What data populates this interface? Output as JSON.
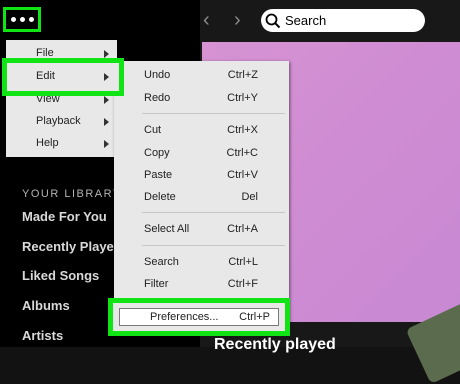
{
  "topbar": {
    "back_arrow": "‹",
    "forward_arrow": "›",
    "search_label": "Search",
    "search_icon": "search-icon"
  },
  "sidebar": {
    "library_heading": "YOUR LIBRARY",
    "items": [
      {
        "label": "Made For You"
      },
      {
        "label": "Recently Played"
      },
      {
        "label": "Liked Songs"
      },
      {
        "label": "Albums"
      },
      {
        "label": "Artists"
      }
    ]
  },
  "main": {
    "section_title": "Recently played"
  },
  "main_menu": {
    "items": [
      {
        "label": "File"
      },
      {
        "label": "Edit"
      },
      {
        "label": "View"
      },
      {
        "label": "Playback"
      },
      {
        "label": "Help"
      }
    ]
  },
  "edit_menu": {
    "items": [
      {
        "label": "Undo",
        "shortcut": "Ctrl+Z"
      },
      {
        "label": "Redo",
        "shortcut": "Ctrl+Y"
      },
      {
        "label": "Cut",
        "shortcut": "Ctrl+X"
      },
      {
        "label": "Copy",
        "shortcut": "Ctrl+C"
      },
      {
        "label": "Paste",
        "shortcut": "Ctrl+V"
      },
      {
        "label": "Delete",
        "shortcut": "Del"
      },
      {
        "label": "Select All",
        "shortcut": "Ctrl+A"
      },
      {
        "label": "Search",
        "shortcut": "Ctrl+L"
      },
      {
        "label": "Filter",
        "shortcut": "Ctrl+F"
      },
      {
        "label": "Preferences...",
        "shortcut": "Ctrl+P"
      }
    ]
  },
  "colors": {
    "highlight": "#11e415",
    "menu_bg": "#e8e8e8",
    "sidebar_bg": "#000000",
    "album_art": "#d693d3"
  }
}
